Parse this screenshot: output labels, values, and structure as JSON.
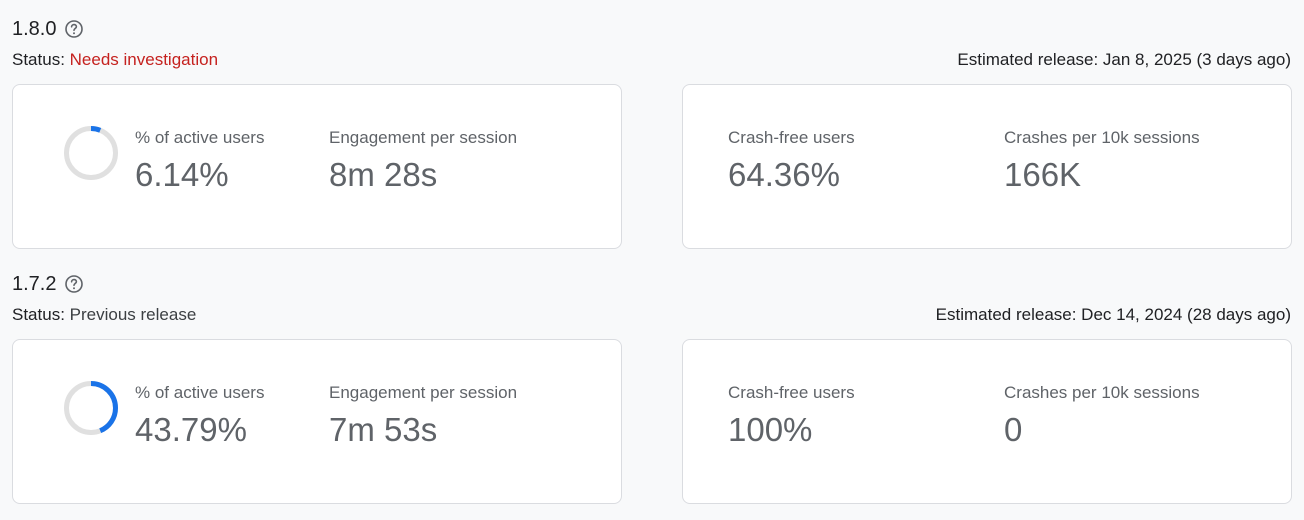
{
  "releases": [
    {
      "version": "1.8.0",
      "status_label": "Status:",
      "status_value": "Needs investigation",
      "estimated_release": "Estimated release: Jan 8, 2025 (3 days ago)",
      "active_users_label": "% of active users",
      "active_users_value": "6.14%",
      "active_users_fraction": 0.0614,
      "engagement_label": "Engagement per session",
      "engagement_value": "8m 28s",
      "crash_free_label": "Crash-free users",
      "crash_free_value": "64.36%",
      "crashes_label": "Crashes per 10k sessions",
      "crashes_value": "166K"
    },
    {
      "version": "1.7.2",
      "status_label": "Status:",
      "status_value": "Previous release",
      "estimated_release": "Estimated release: Dec 14, 2024 (28 days ago)",
      "active_users_label": "% of active users",
      "active_users_value": "43.79%",
      "active_users_fraction": 0.4379,
      "engagement_label": "Engagement per session",
      "engagement_value": "7m 53s",
      "crash_free_label": "Crash-free users",
      "crash_free_value": "100%",
      "crashes_label": "Crashes per 10k sessions",
      "crashes_value": "0"
    }
  ],
  "colors": {
    "alert": "#c5221f",
    "donut_fill": "#1a73e8",
    "donut_track": "#e0e0e0"
  },
  "icons": {
    "help": "help-circle-icon"
  }
}
